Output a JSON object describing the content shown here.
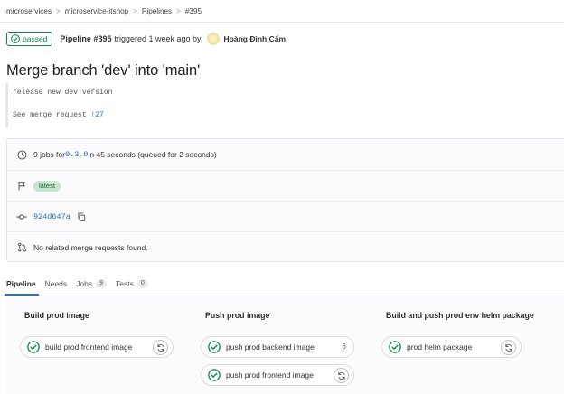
{
  "breadcrumb": {
    "items": [
      "microservices",
      "microservice-itshop",
      "Pipelines",
      "#395"
    ],
    "separator": ">"
  },
  "status": {
    "badge_label": "passed",
    "pipeline_label": "Pipeline #395",
    "triggered_text": "triggered 1 week ago by",
    "author": "Hoàng Đình Cẩm"
  },
  "commit": {
    "title": "Merge branch 'dev' into 'main'",
    "description_line1": "release new dev version",
    "description_line2_prefix": "See merge request ",
    "merge_request_ref": "!27"
  },
  "info": {
    "jobs_prefix": "9 jobs for ",
    "ref": "0.3.0",
    "jobs_suffix": " in 45 seconds (queued for 2 seconds)",
    "latest_badge": "latest",
    "commit_sha": "924d647a",
    "merge_requests_text": "No related merge requests found."
  },
  "tabs": [
    {
      "label": "Pipeline",
      "count": null,
      "active": true
    },
    {
      "label": "Needs",
      "count": null,
      "active": false
    },
    {
      "label": "Jobs",
      "count": "9",
      "active": false
    },
    {
      "label": "Tests",
      "count": "0",
      "active": false
    }
  ],
  "stages": [
    {
      "title": "Build prod image",
      "jobs": [
        {
          "name": "build prod frontend image",
          "action": "retry",
          "extra": null
        }
      ]
    },
    {
      "title": "Push prod image",
      "jobs": [
        {
          "name": "push prod backend image",
          "action": "group",
          "extra": "6"
        },
        {
          "name": "push prod frontend image",
          "action": "retry",
          "extra": null
        }
      ]
    },
    {
      "title": "Build and push prod env helm package",
      "jobs": [
        {
          "name": "prod helm package",
          "action": "retry",
          "extra": null
        }
      ]
    }
  ],
  "colors": {
    "success": "#108548",
    "link": "#1f75cb",
    "tab_active_underline": "#1f75cb",
    "latest_badge_bg": "#c3e6cd"
  },
  "icons": {
    "status": "check-circle-icon",
    "duration": "clock-icon",
    "flag": "flag-icon",
    "commit": "commit-icon",
    "copy": "copy-icon",
    "merge_request": "merge-request-icon",
    "retry": "retry-icon"
  }
}
